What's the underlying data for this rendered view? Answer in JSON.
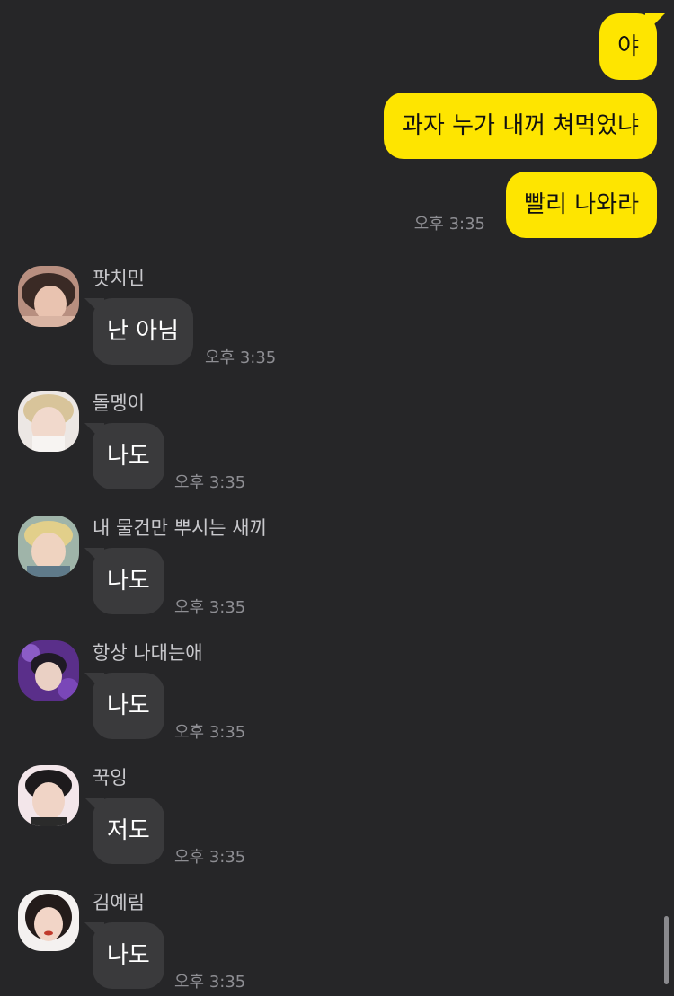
{
  "colors": {
    "background": "#262628",
    "outgoing_bubble": "#fee500",
    "incoming_bubble": "#3a3a3c",
    "timestamp": "#8e8e93"
  },
  "outgoing": {
    "messages": [
      "야",
      "과자 누가 내꺼 쳐먹었냐",
      "빨리 나와라"
    ],
    "time": "오후 3:35"
  },
  "incoming": [
    {
      "sender": "팟치민",
      "text": "난 아님",
      "time": "오후 3:35"
    },
    {
      "sender": "돌멩이",
      "text": "나도",
      "time": "오후 3:35"
    },
    {
      "sender": "내 물건만 뿌시는 새끼",
      "text": "나도",
      "time": "오후 3:35"
    },
    {
      "sender": "항상 나대는애",
      "text": "나도",
      "time": "오후 3:35"
    },
    {
      "sender": "꾹잉",
      "text": "저도",
      "time": "오후 3:35"
    },
    {
      "sender": "김예림",
      "text": "나도",
      "time": "오후 3:35"
    }
  ]
}
